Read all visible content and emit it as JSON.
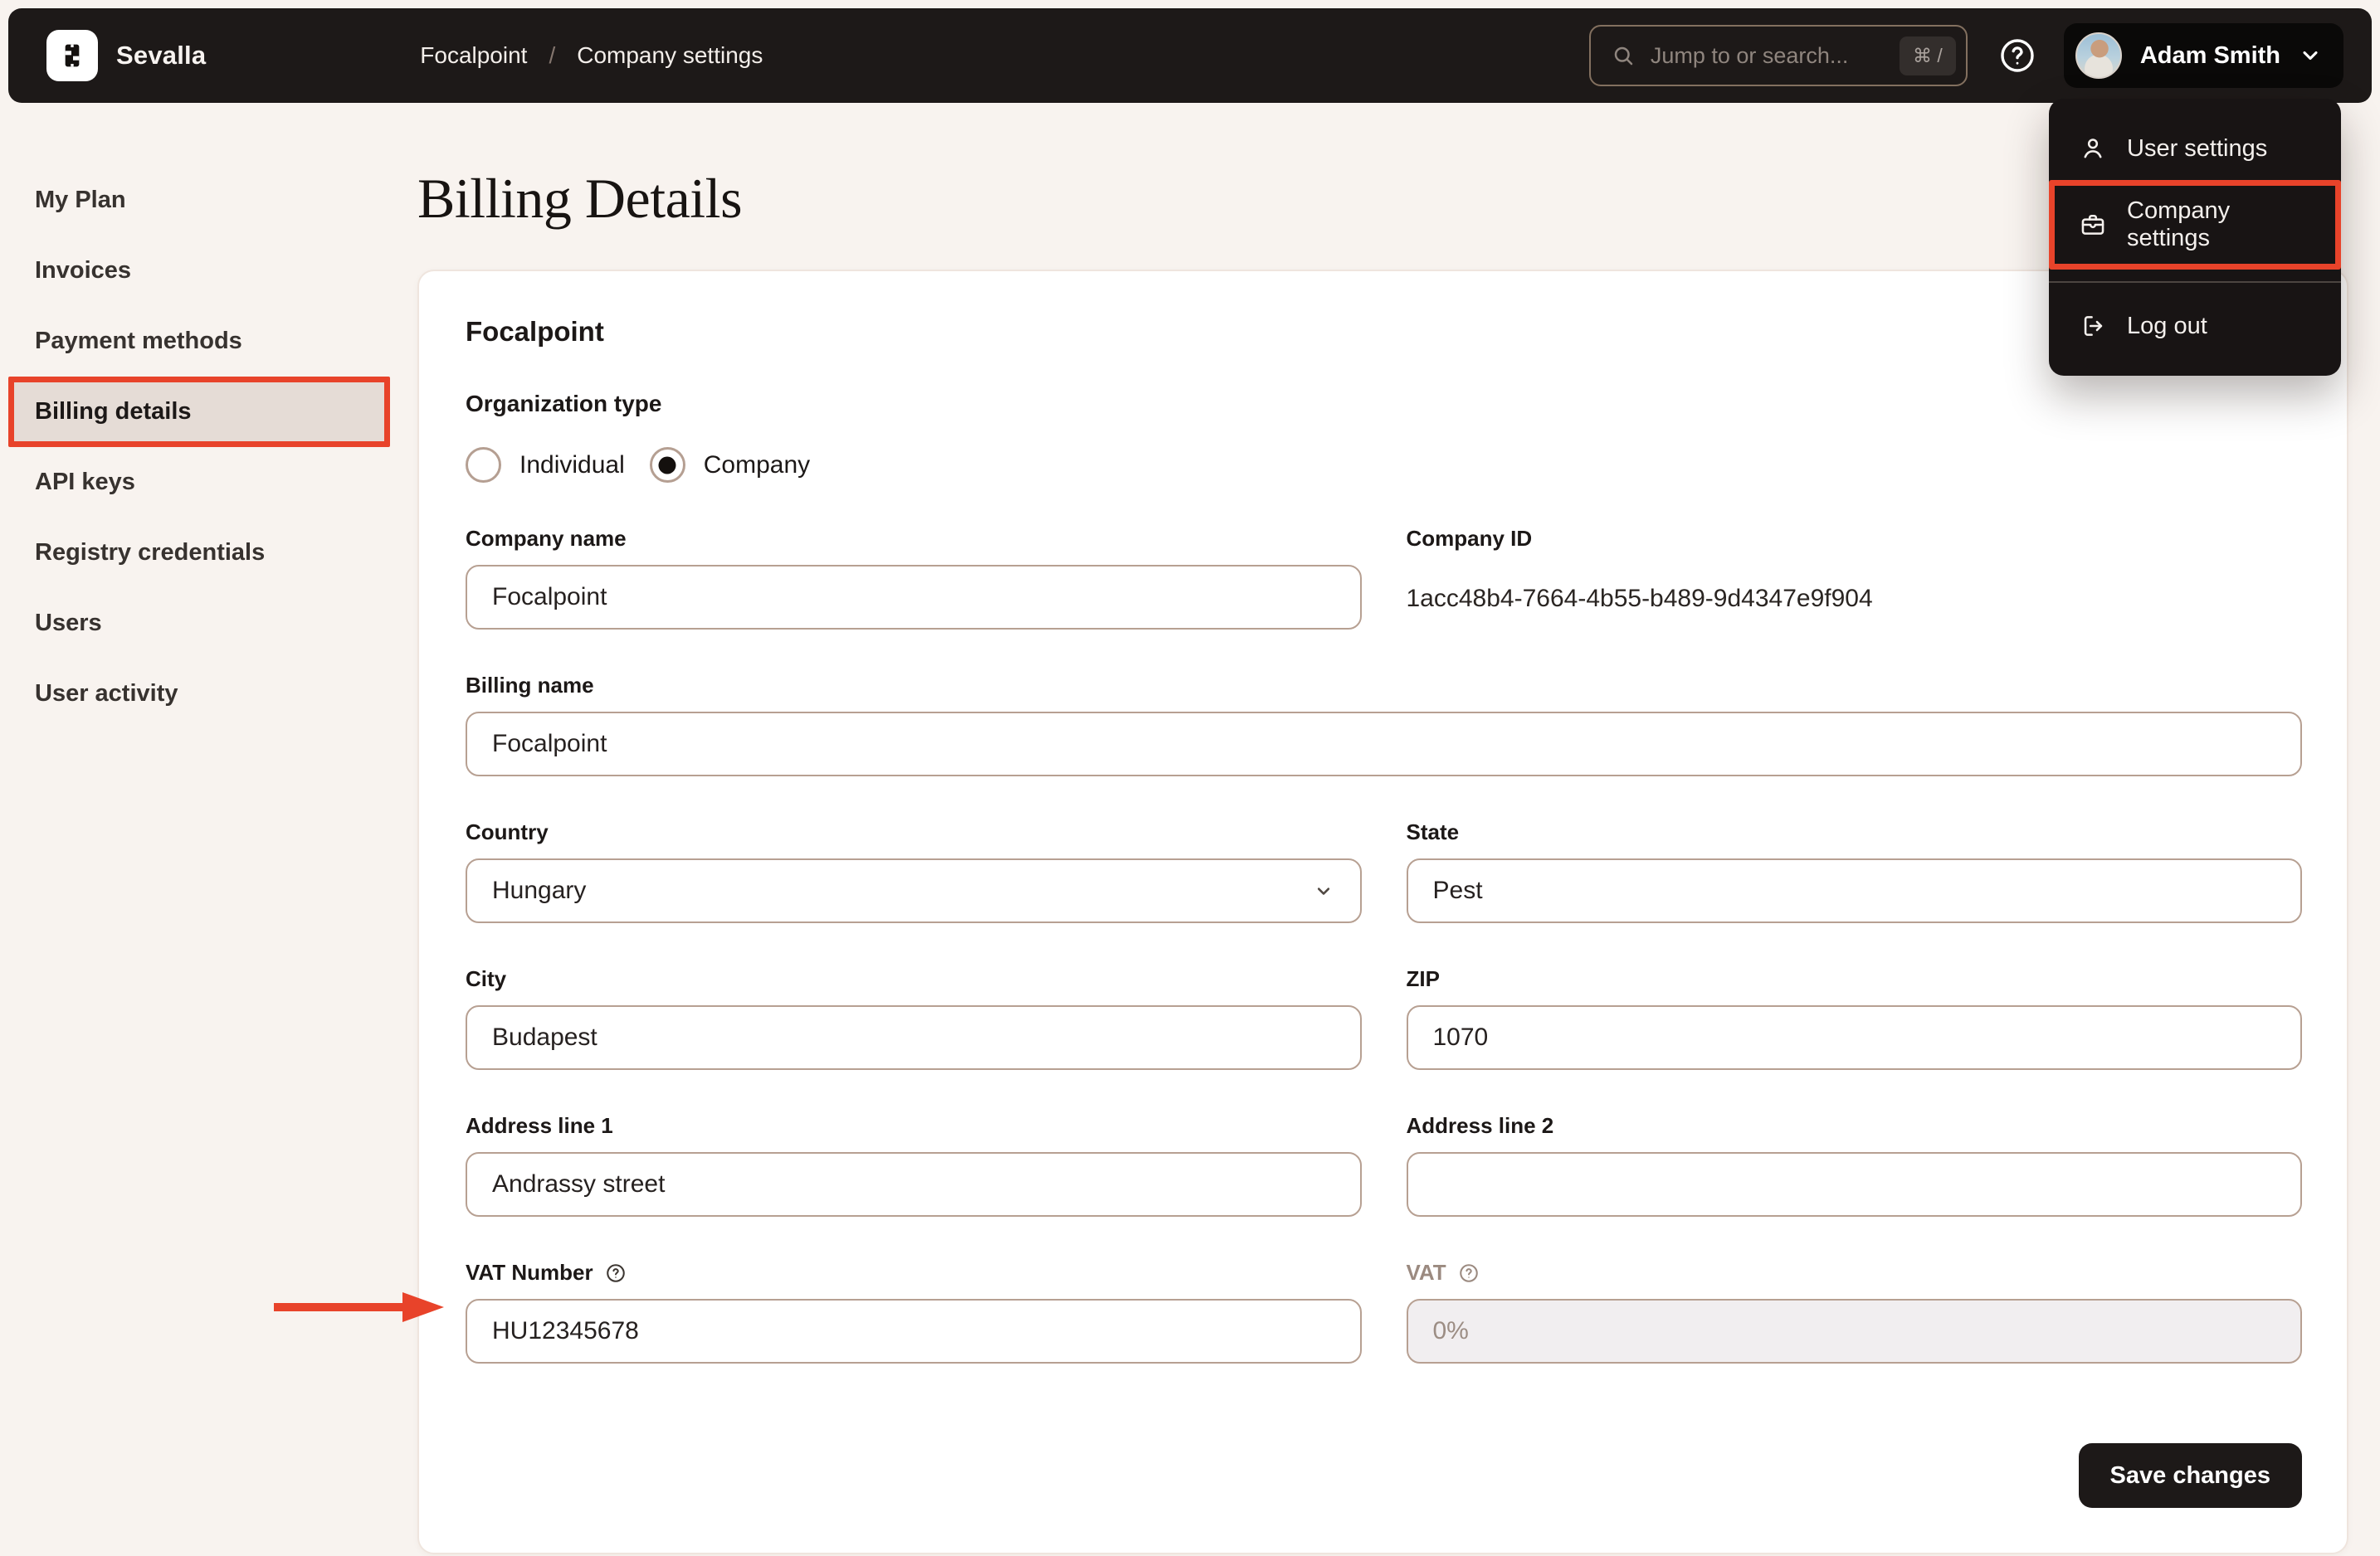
{
  "topbar": {
    "brand": "Sevalla",
    "breadcrumb": {
      "item1": "Focalpoint",
      "separator": "/",
      "item2": "Company settings"
    },
    "search_placeholder": "Jump to or search...",
    "search_shortcut": "⌘ /",
    "user_name": "Adam Smith"
  },
  "user_menu": {
    "user_settings": "User settings",
    "company_settings": "Company settings",
    "log_out": "Log out"
  },
  "sidebar": {
    "items": [
      "My Plan",
      "Invoices",
      "Payment methods",
      "Billing details",
      "API keys",
      "Registry credentials",
      "Users",
      "User activity"
    ],
    "active_item": "Billing details"
  },
  "page": {
    "title": "Billing Details"
  },
  "form": {
    "card_title": "Focalpoint",
    "organization_type": {
      "label": "Organization type",
      "options": [
        {
          "label": "Individual",
          "selected": false
        },
        {
          "label": "Company",
          "selected": true
        }
      ]
    },
    "company_name": {
      "label": "Company name",
      "value": "Focalpoint"
    },
    "company_id": {
      "label": "Company ID",
      "value": "1acc48b4-7664-4b55-b489-9d4347e9f904"
    },
    "billing_name": {
      "label": "Billing name",
      "value": "Focalpoint"
    },
    "country": {
      "label": "Country",
      "value": "Hungary"
    },
    "state": {
      "label": "State",
      "value": "Pest"
    },
    "city": {
      "label": "City",
      "value": "Budapest"
    },
    "zip": {
      "label": "ZIP",
      "value": "1070"
    },
    "address1": {
      "label": "Address line 1",
      "value": "Andrassy street"
    },
    "address2": {
      "label": "Address line 2",
      "value": ""
    },
    "vat_number": {
      "label": "VAT Number",
      "value": "HU12345678"
    },
    "vat": {
      "label": "VAT",
      "value": "0%",
      "disabled": true
    },
    "save_label": "Save changes"
  },
  "colors": {
    "annotation_red": "#e8432a",
    "topbar_bg": "#1d1918",
    "page_bg": "#f8f3ef",
    "input_border": "#b7a092",
    "active_sidebar_bg": "#e5dcd6"
  }
}
